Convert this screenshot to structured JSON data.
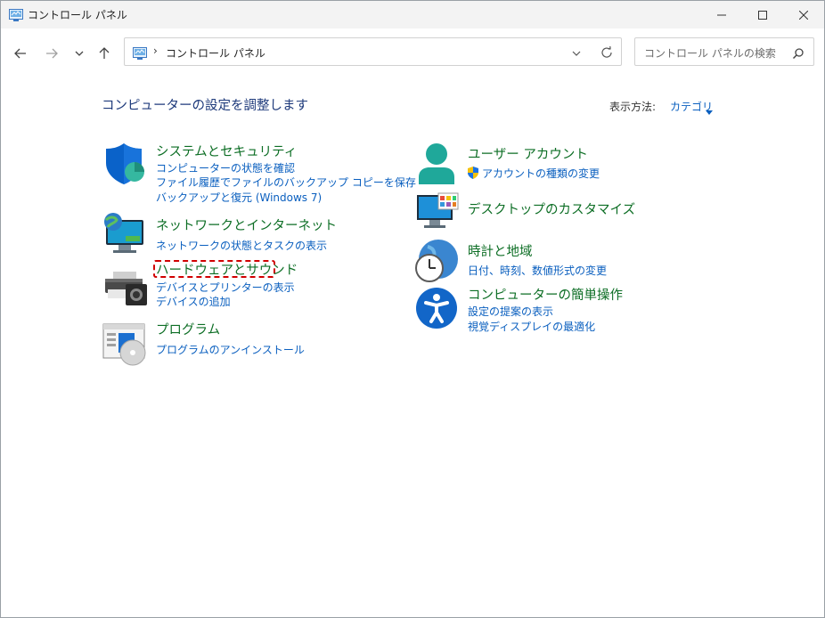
{
  "window": {
    "title": "コントロール パネル"
  },
  "nav": {
    "address_path": "コントロール パネル",
    "address_separator": "›",
    "search_placeholder": "コントロール パネルの検索"
  },
  "main": {
    "heading": "コンピューターの設定を調整します",
    "view_by_label": "表示方法:",
    "view_by_value": "カテゴリ"
  },
  "categories": {
    "system": {
      "title": "システムとセキュリティ",
      "links": [
        "コンピューターの状態を確認",
        "ファイル履歴でファイルのバックアップ コピーを保存",
        "バックアップと復元 (Windows 7)"
      ]
    },
    "network": {
      "title": "ネットワークとインターネット",
      "links": [
        "ネットワークの状態とタスクの表示"
      ]
    },
    "hardware": {
      "title": "ハードウェアとサウンド",
      "links": [
        "デバイスとプリンターの表示",
        "デバイスの追加"
      ]
    },
    "programs": {
      "title": "プログラム",
      "links": [
        "プログラムのアンインストール"
      ]
    },
    "user": {
      "title": "ユーザー アカウント",
      "links": [
        "アカウントの種類の変更"
      ]
    },
    "desktop": {
      "title": "デスクトップのカスタマイズ",
      "links": []
    },
    "clock": {
      "title": "時計と地域",
      "links": [
        "日付、時刻、数値形式の変更"
      ]
    },
    "access": {
      "title": "コンピューターの簡単操作",
      "links": [
        "設定の提案の表示",
        "視覚ディスプレイの最適化"
      ]
    }
  },
  "colors": {
    "category_title": "#0d6e25",
    "link": "#0a5fbf",
    "heading": "#1e3a7b",
    "highlight": "#d00000"
  }
}
